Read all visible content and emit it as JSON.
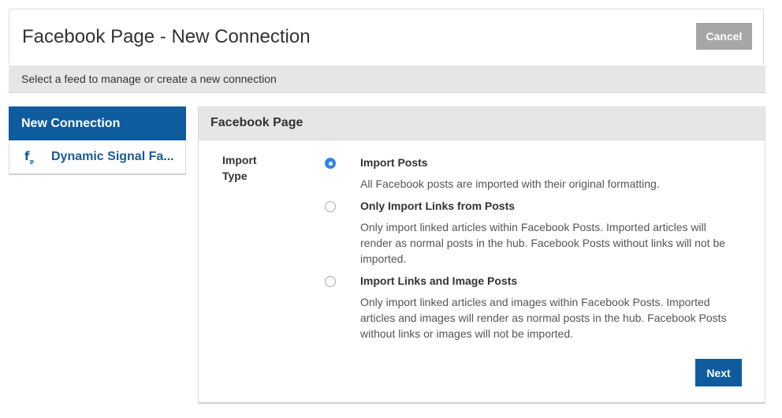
{
  "header": {
    "title": "Facebook Page - New Connection",
    "cancel_label": "Cancel"
  },
  "subheader": {
    "text": "Select a feed to manage or create a new connection"
  },
  "sidebar": {
    "head_label": "New Connection",
    "items": [
      {
        "label": "Dynamic Signal Fa...",
        "icon": "facebook-page-icon"
      }
    ]
  },
  "panel": {
    "title": "Facebook Page",
    "field_label": "Import Type",
    "options": [
      {
        "title": "Import Posts",
        "description": "All Facebook posts are imported with their original formatting.",
        "selected": true
      },
      {
        "title": "Only Import Links from Posts",
        "description": "Only import linked articles within Facebook Posts. Imported articles will render as normal posts in the hub. Facebook Posts without links will not be imported.",
        "selected": false
      },
      {
        "title": "Import Links and Image Posts",
        "description": "Only import linked articles and images within Facebook Posts. Imported articles and images will render as normal posts in the hub. Facebook Posts without links or images will not be imported.",
        "selected": false
      }
    ],
    "next_label": "Next"
  },
  "colors": {
    "primary": "#0e5c9e",
    "radio_selected": "#2e86e8",
    "cancel_bg": "#a6a6a6",
    "subheader_bg": "#e6e6e6"
  }
}
